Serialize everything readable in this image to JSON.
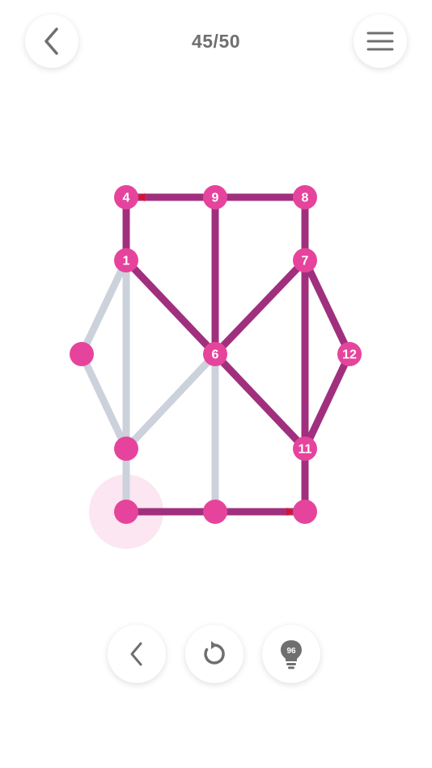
{
  "header": {
    "level_counter": "45/50"
  },
  "icons": {
    "back": "chevron-left-icon",
    "menu": "hamburger-menu-icon",
    "undo": "chevron-left-icon",
    "restart": "restart-icon",
    "hint": "lightbulb-icon"
  },
  "toolbar": {
    "hint_count": "96"
  },
  "colors": {
    "drawn_edge": "#a0307e",
    "undrawn_edge": "#ccd2db",
    "node": "#e6449c",
    "arrow": "#e0102a",
    "start_glow": "#fbe6f1",
    "icon": "#6f6f6f"
  },
  "puzzle": {
    "nodes": [
      {
        "id": "A",
        "label": "4"
      },
      {
        "id": "B",
        "label": "9"
      },
      {
        "id": "C",
        "label": "8"
      },
      {
        "id": "D",
        "label": "1"
      },
      {
        "id": "E",
        "label": "7"
      },
      {
        "id": "F",
        "label": ""
      },
      {
        "id": "G",
        "label": "6"
      },
      {
        "id": "H",
        "label": "12"
      },
      {
        "id": "I",
        "label": ""
      },
      {
        "id": "J",
        "label": "11"
      },
      {
        "id": "K",
        "label": ""
      },
      {
        "id": "L",
        "label": ""
      },
      {
        "id": "M",
        "label": ""
      }
    ],
    "edges": [
      {
        "from": "A",
        "to": "B",
        "drawn": true
      },
      {
        "from": "B",
        "to": "C",
        "drawn": true
      },
      {
        "from": "A",
        "to": "D",
        "drawn": true
      },
      {
        "from": "B",
        "to": "G",
        "drawn": true
      },
      {
        "from": "C",
        "to": "E",
        "drawn": true
      },
      {
        "from": "D",
        "to": "G",
        "drawn": true
      },
      {
        "from": "E",
        "to": "G",
        "drawn": true
      },
      {
        "from": "E",
        "to": "H",
        "drawn": true
      },
      {
        "from": "E",
        "to": "J",
        "drawn": true
      },
      {
        "from": "G",
        "to": "J",
        "drawn": true
      },
      {
        "from": "H",
        "to": "J",
        "drawn": true
      },
      {
        "from": "J",
        "to": "M",
        "drawn": true
      },
      {
        "from": "K",
        "to": "L",
        "drawn": true
      },
      {
        "from": "L",
        "to": "M",
        "drawn": true
      },
      {
        "from": "D",
        "to": "F",
        "drawn": false
      },
      {
        "from": "D",
        "to": "I",
        "drawn": false
      },
      {
        "from": "F",
        "to": "I",
        "drawn": false
      },
      {
        "from": "G",
        "to": "I",
        "drawn": false
      },
      {
        "from": "I",
        "to": "K",
        "drawn": false
      },
      {
        "from": "G",
        "to": "L",
        "drawn": false
      }
    ],
    "current_node": "K",
    "arrows": [
      {
        "node": "A",
        "pointing_from": "B"
      },
      {
        "node": "M",
        "pointing_from": "L"
      }
    ]
  }
}
